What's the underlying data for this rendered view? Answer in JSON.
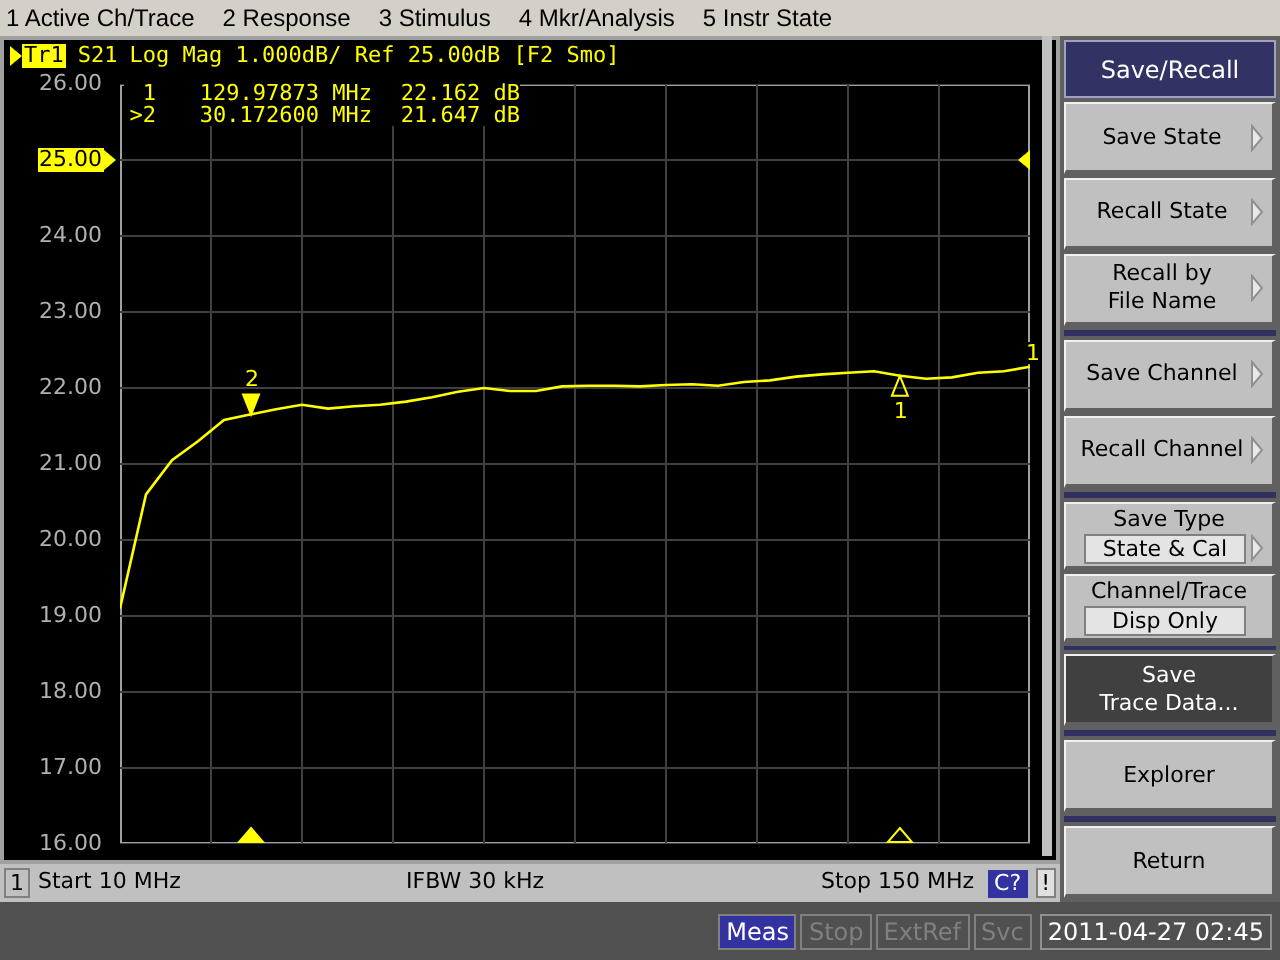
{
  "menu_bar": [
    "1 Active Ch/Trace",
    "2 Response",
    "3 Stimulus",
    "4 Mkr/Analysis",
    "5 Instr State"
  ],
  "trace_header": {
    "trace": "Tr1",
    "text": "Log Mag 1.000dB/ Ref 25.00dB [F2 Smo]"
  },
  "markers": [
    {
      "id": "1",
      "label": "1",
      "frequency": "129.97873 MHz",
      "value": "22.162 dB",
      "selected": false
    },
    {
      "id": ">2",
      "label": "2",
      "frequency": "30.172600 MHz",
      "value": "21.647 dB",
      "selected": true
    }
  ],
  "trace_end_label": "1",
  "reference_marker": {
    "shown": true
  },
  "chart_data": {
    "type": "line",
    "ylim": [
      16,
      26
    ],
    "grid": true,
    "yticks": [
      {
        "value": 26,
        "label": "26.00"
      },
      {
        "value": 25,
        "label": "25.00"
      },
      {
        "value": 24,
        "label": "24.00"
      },
      {
        "value": 23,
        "label": "23.00"
      },
      {
        "value": 22,
        "label": "22.00"
      },
      {
        "value": 21,
        "label": "21.00"
      },
      {
        "value": 20,
        "label": "20.00"
      },
      {
        "value": 19,
        "label": "19.00"
      },
      {
        "value": 18,
        "label": "18.00"
      },
      {
        "value": 17,
        "label": "17.00"
      },
      {
        "value": 16,
        "label": "16.00"
      }
    ],
    "categories": [
      null,
      null,
      null,
      null,
      null,
      null,
      null,
      null,
      null,
      null,
      null,
      null,
      null,
      null,
      null,
      null,
      null,
      null,
      null,
      null,
      null,
      null,
      null,
      null,
      null,
      null,
      null,
      null,
      null,
      null,
      null,
      null,
      null,
      null,
      null,
      null
    ],
    "series": [
      {
        "name": "S21",
        "color": "#ffff00",
        "values": [
          19.1,
          20.6,
          21.05,
          21.3,
          21.58,
          21.65,
          21.72,
          21.78,
          21.73,
          21.76,
          21.78,
          21.82,
          21.88,
          21.95,
          22.0,
          21.96,
          21.96,
          22.02,
          22.03,
          22.03,
          22.02,
          22.04,
          22.05,
          22.03,
          22.08,
          22.1,
          22.15,
          22.18,
          22.2,
          22.22,
          22.16,
          22.12,
          22.14,
          22.2,
          22.22,
          22.28
        ]
      }
    ]
  },
  "channel_status": {
    "channel": "1",
    "start": "Start 10 MHz",
    "ifbw": "IFBW 30 kHz",
    "stop": "Stop 150 MHz",
    "cal": "C?",
    "alert": "!"
  },
  "menu_title": "Save/Recall",
  "softkey_groups": [
    [
      {
        "kind": "submenu",
        "lines": [
          "Save State"
        ]
      },
      {
        "kind": "submenu",
        "lines": [
          "Recall State"
        ]
      },
      {
        "kind": "submenu",
        "lines": [
          "Recall by",
          "File Name"
        ]
      }
    ],
    [
      {
        "kind": "submenu",
        "lines": [
          "Save Channel"
        ]
      },
      {
        "kind": "submenu",
        "lines": [
          "Recall Channel"
        ]
      }
    ],
    [
      {
        "kind": "value",
        "lines": [
          "Save Type"
        ],
        "value": "State & Cal",
        "arrow": true
      },
      {
        "kind": "value",
        "lines": [
          "Channel/Trace"
        ],
        "value": "Disp Only",
        "arrow": false
      }
    ],
    [
      {
        "kind": "action",
        "lines": [
          "Save",
          "Trace Data..."
        ],
        "selected": true
      }
    ],
    [
      {
        "kind": "action",
        "lines": [
          "Explorer"
        ],
        "selected": false
      }
    ],
    [
      {
        "kind": "action",
        "lines": [
          "Return"
        ],
        "selected": false
      }
    ]
  ],
  "status_bar": [
    {
      "label": "Meas",
      "selected": true
    },
    {
      "label": "Stop",
      "selected": false
    },
    {
      "label": "ExtRef",
      "selected": false
    },
    {
      "label": "Svc",
      "selected": false
    }
  ],
  "datetime": "2011-04-27 02:45"
}
